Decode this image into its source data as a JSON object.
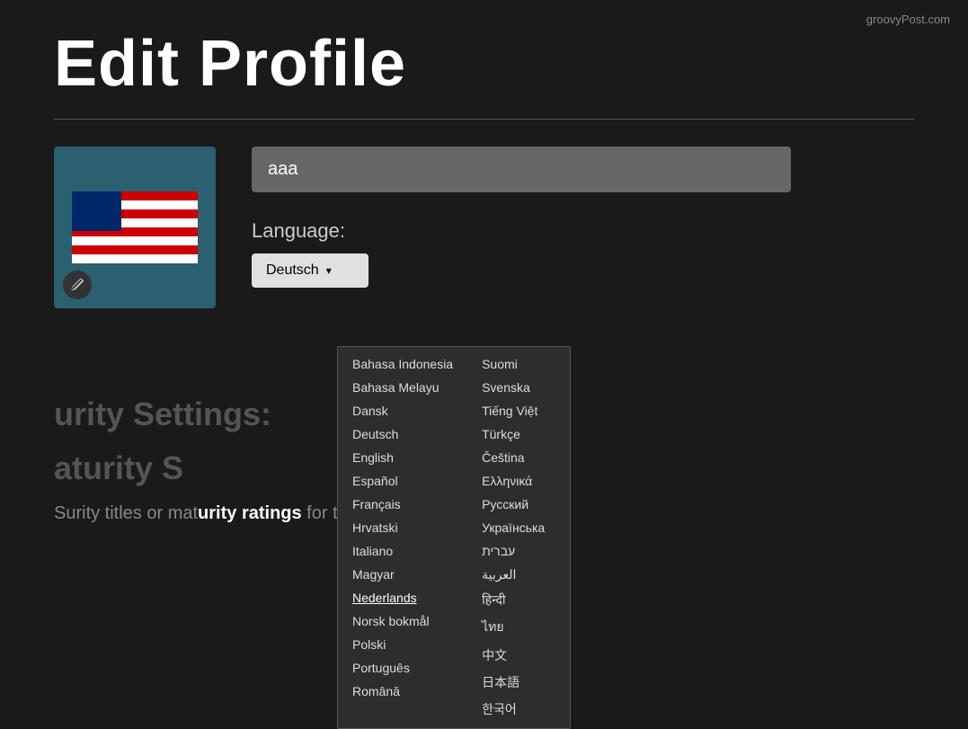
{
  "watermark": {
    "text": "groovyPost.com"
  },
  "page": {
    "title": "Edit Profile"
  },
  "form": {
    "name_value": "aaa",
    "name_placeholder": "aaa",
    "language_label": "Language:",
    "selected_language": "Deutsch"
  },
  "dropdown": {
    "selected": "Deutsch",
    "arrow": "▾",
    "left_column": [
      "Bahasa Indonesia",
      "Bahasa Melayu",
      "Dansk",
      "Deutsch",
      "English",
      "Español",
      "Français",
      "Hrvatski",
      "Italiano",
      "Magyar",
      "Nederlands",
      "Norsk bokmål",
      "Polski",
      "Português",
      "Română"
    ],
    "right_column": [
      "Suomi",
      "Svenska",
      "Tiếng Việt",
      "Türkçe",
      "Čeština",
      "Ελληνικά",
      "Русский",
      "Українська",
      "עברית",
      "العربية",
      "हिन्दी",
      "ไทย",
      "中文",
      "日本語",
      "한국어"
    ]
  },
  "background": {
    "security_title": "urity Settings:",
    "maturity_title": "aturity S",
    "maturity_desc_prefix": "S",
    "maturity_desc_middle": "urity titles or mat",
    "maturity_desc_suffix": "urity ratings for this profile."
  },
  "icons": {
    "edit": "✏"
  }
}
